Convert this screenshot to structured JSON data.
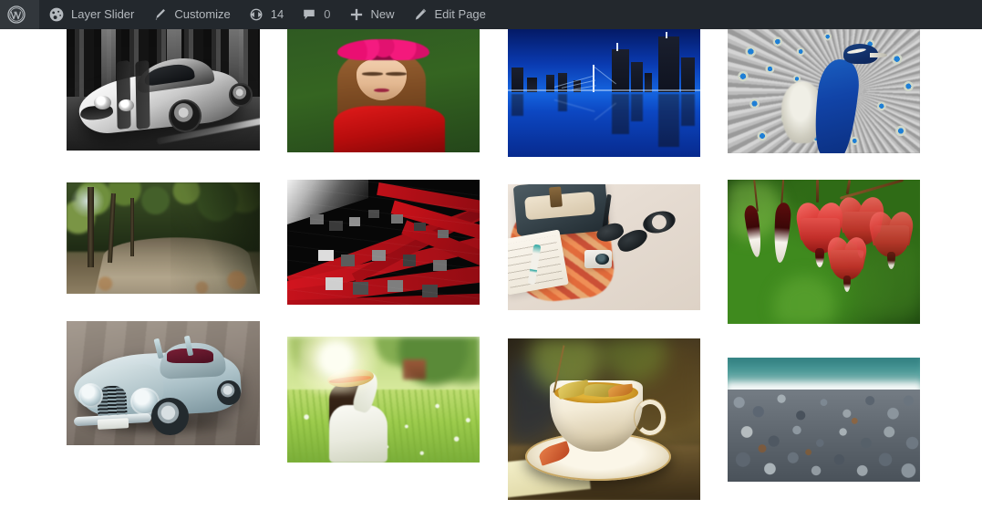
{
  "admin_bar": {
    "background": "#23282d",
    "text_color": "#b4b9be",
    "items": [
      {
        "id": "wp-logo",
        "icon": "wordpress-logo-icon",
        "label": "",
        "count": null
      },
      {
        "id": "layerslider",
        "icon": "dashboard-gauge-icon",
        "label": "Layer Slider",
        "count": null
      },
      {
        "id": "customize",
        "icon": "paintbrush-icon",
        "label": "Customize",
        "count": null
      },
      {
        "id": "updates",
        "icon": "update-arrows-icon",
        "label": "",
        "count": "14"
      },
      {
        "id": "comments",
        "icon": "comment-bubble-icon",
        "label": "",
        "count": "0"
      },
      {
        "id": "new-content",
        "icon": "plus-icon",
        "label": "New",
        "count": null
      },
      {
        "id": "edit-page",
        "icon": "pencil-icon",
        "label": "Edit Page",
        "count": null
      }
    ]
  },
  "gallery": {
    "layout": "masonry",
    "columns": 4,
    "background": "#ffffff",
    "items": [
      {
        "id": "sports-car",
        "caption": "White sports car in black and white",
        "column": 1,
        "row": 1
      },
      {
        "id": "rose-crown",
        "caption": "Woman with pink rose flower crown",
        "column": 2,
        "row": 1
      },
      {
        "id": "city-skyline",
        "caption": "City skyline at night reflected in water",
        "column": 3,
        "row": 1
      },
      {
        "id": "peacock",
        "caption": "Peacock with fanned tail feathers",
        "column": 4,
        "row": 1
      },
      {
        "id": "forest-road",
        "caption": "Autumn forest dirt road",
        "column": 1,
        "row": 2
      },
      {
        "id": "red-building",
        "caption": "Red and black building facade perspective",
        "column": 2,
        "row": 2
      },
      {
        "id": "travel-flatlay",
        "caption": "Travel accessories flat lay",
        "column": 3,
        "row": 2
      },
      {
        "id": "bleeding-heart",
        "caption": "Red bleeding heart flowers",
        "column": 4,
        "row": 2
      },
      {
        "id": "vintage-car",
        "caption": "Vintage blue convertible car",
        "column": 1,
        "row": 3
      },
      {
        "id": "meadow-woman",
        "caption": "Woman in straw hat in sunlit daisy meadow",
        "column": 2,
        "row": 3
      },
      {
        "id": "teacup",
        "caption": "Vintage teacup with autumn leaves",
        "column": 3,
        "row": 3
      },
      {
        "id": "pebble-beach",
        "caption": "Pebble beach with ocean waves",
        "column": 4,
        "row": 3
      }
    ]
  }
}
